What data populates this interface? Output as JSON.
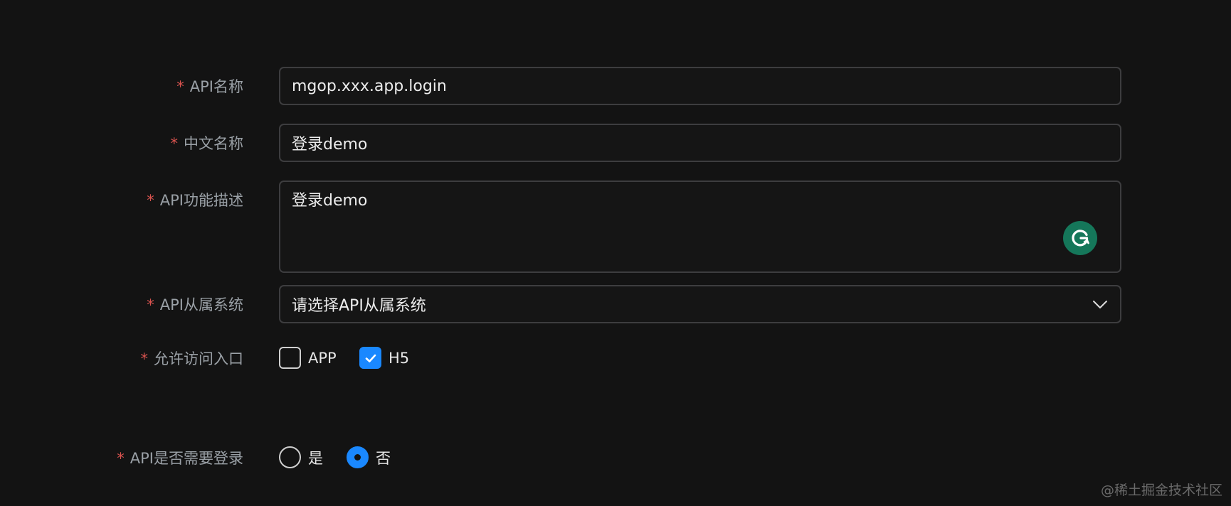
{
  "form": {
    "api_name": {
      "label": "API名称",
      "value": "mgop.xxx.app.login"
    },
    "cn_name": {
      "label": "中文名称",
      "value": "登录demo"
    },
    "description": {
      "label": "API功能描述",
      "value": "登录demo"
    },
    "system": {
      "label": "API从属系统",
      "placeholder": "请选择API从属系统"
    },
    "access": {
      "label": "允许访问入口",
      "options": [
        {
          "label": "APP",
          "checked": false
        },
        {
          "label": "H5",
          "checked": true
        }
      ]
    },
    "login_required": {
      "label": "API是否需要登录",
      "options": [
        {
          "label": "是",
          "selected": false
        },
        {
          "label": "否",
          "selected": true
        }
      ]
    },
    "required_mark": "*"
  },
  "watermark": "@稀土掘金技术社区",
  "icons": {
    "grammarly": "grammarly-icon",
    "select_arrow": "chevron-down-icon",
    "checkbox_check": "checkmark-icon"
  },
  "colors": {
    "background": "#131313",
    "accent": "#1a88ff",
    "required": "#d9534f",
    "grammarly": "#15775a"
  }
}
